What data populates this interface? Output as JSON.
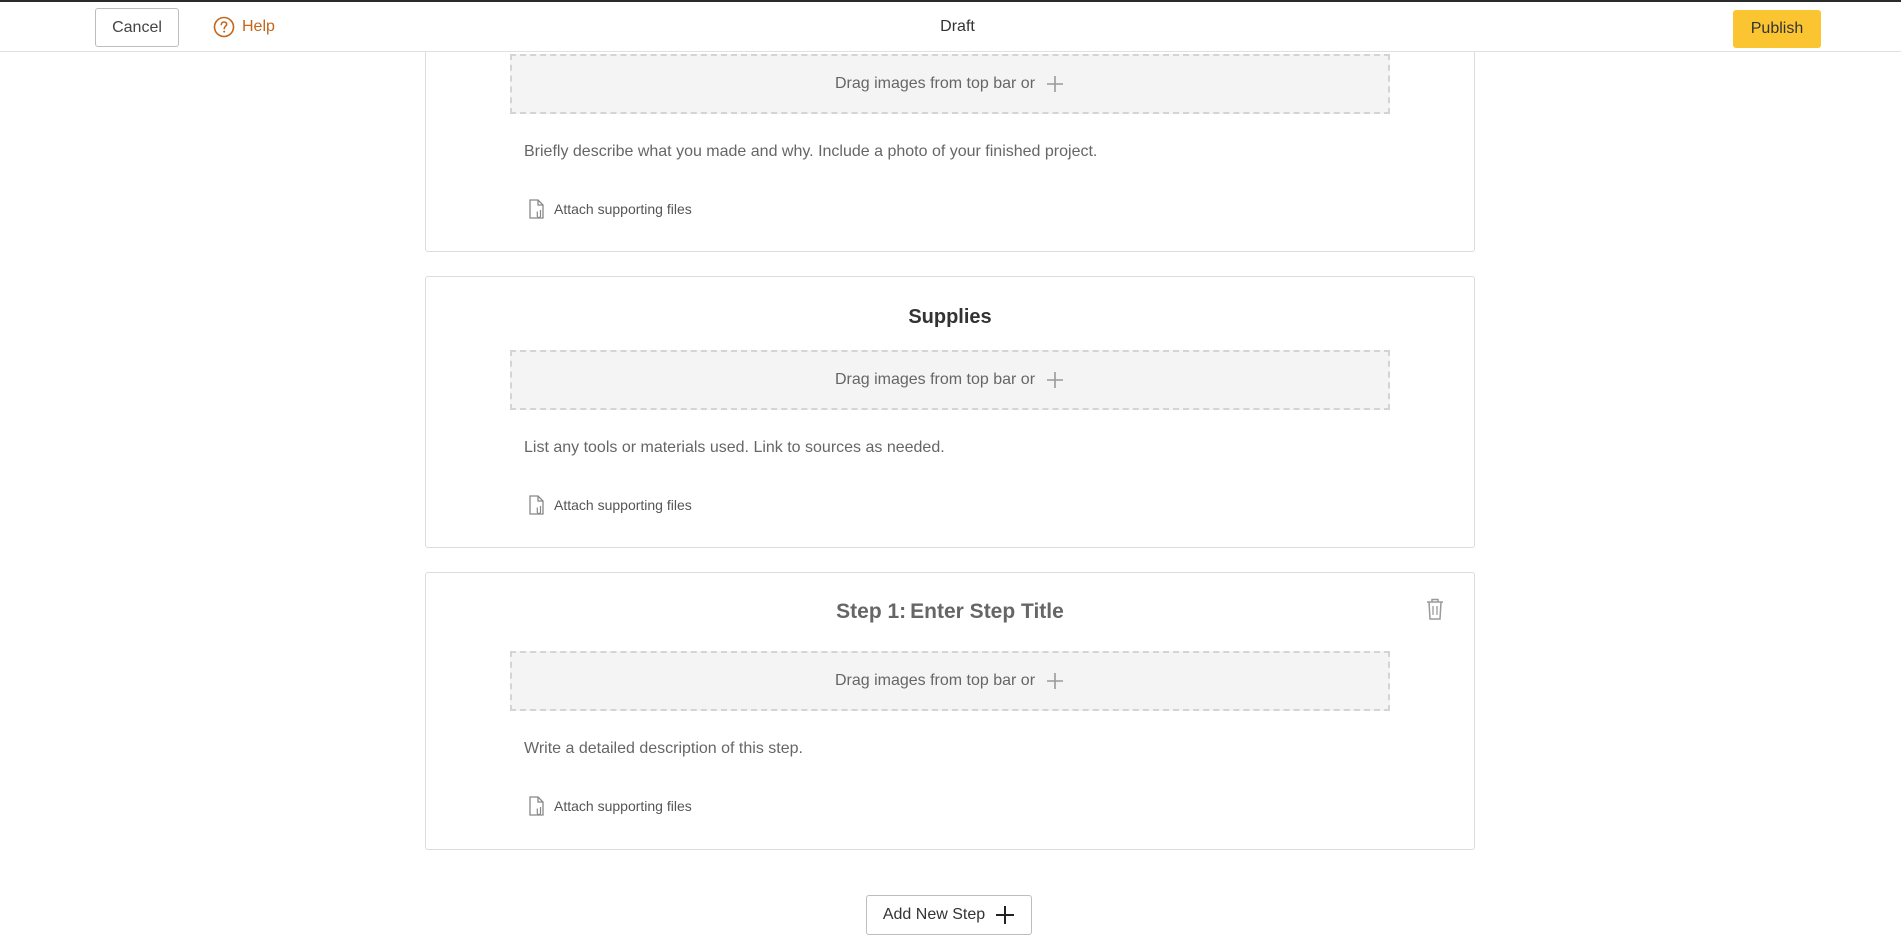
{
  "topbar": {
    "cancel_label": "Cancel",
    "help_label": "Help",
    "title": "Draft",
    "publish_label": "Publish"
  },
  "intro": {
    "dropzone_label": "Drag images from top bar or",
    "description": "Briefly describe what you made and why. Include a photo of your finished project.",
    "attach_label": "Attach supporting files"
  },
  "supplies": {
    "title": "Supplies",
    "dropzone_label": "Drag images from top bar or",
    "description": "List any tools or materials used. Link to sources as needed.",
    "attach_label": "Attach supporting files"
  },
  "step1": {
    "step_label": "Step 1:",
    "title_placeholder": "Enter Step Title",
    "dropzone_label": "Drag images from top bar or",
    "description": "Write a detailed description of this step.",
    "attach_label": "Attach supporting files"
  },
  "add_step_label": "Add New Step",
  "colors": {
    "publish_bg": "#fbc531",
    "help_color": "#c4651a",
    "dropzone_bg": "#f4f4f4"
  }
}
